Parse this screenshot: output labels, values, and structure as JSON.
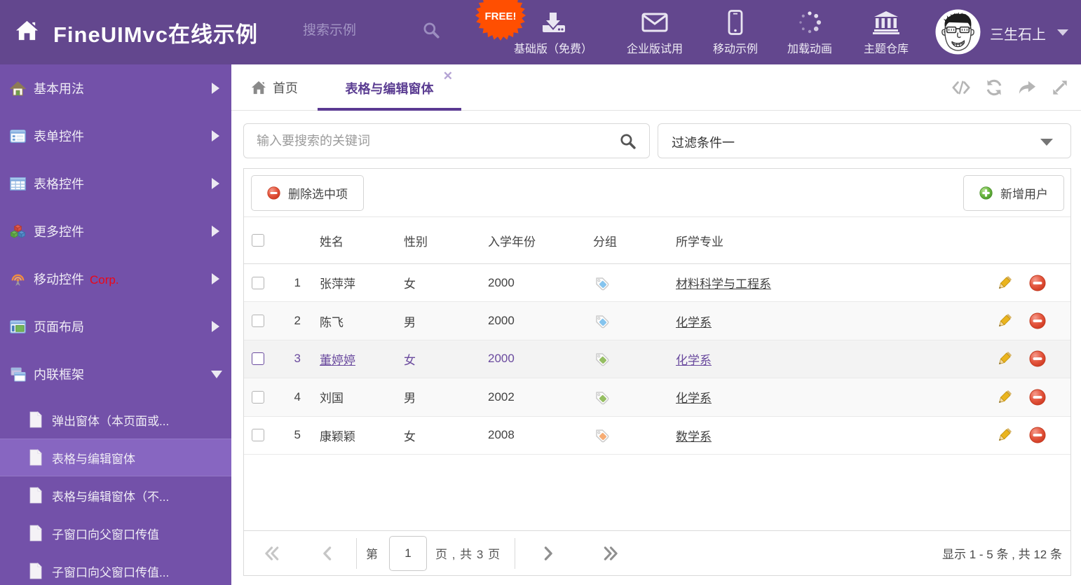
{
  "colors": {
    "header_bg": "#63478e",
    "sidebar_bg": "#7351a9",
    "sidebar_selected_bg": "#8766c1",
    "accent_purple": "#5b3d92",
    "selected_row_text": "#6a4a9e",
    "free_badge": "#ff4f01",
    "corp_red": "#ec0718",
    "tag_blue": "#85c4ee",
    "tag_green": "#95be62",
    "tag_orange": "#f6ac74",
    "pencil_gold": "#e8b31c",
    "delete_red": "#dd4936",
    "add_green": "#5fb140"
  },
  "header": {
    "title": "FineUIMvc在线示例",
    "search_placeholder": "搜索示例",
    "free_badge": "FREE!",
    "nav_items": [
      {
        "icon": "download-icon",
        "label": "基础版（免费）"
      },
      {
        "icon": "envelope-icon",
        "label": "企业版试用"
      },
      {
        "icon": "mobile-icon",
        "label": "移动示例"
      },
      {
        "icon": "spinner-icon",
        "label": "加载动画"
      },
      {
        "icon": "bank-icon",
        "label": "主题仓库"
      }
    ],
    "user": {
      "name": "三生石上"
    }
  },
  "sidebar": {
    "items": [
      {
        "icon": "home-icon",
        "label": "基本用法",
        "badge": "",
        "expanded": false
      },
      {
        "icon": "form-icon",
        "label": "表单控件",
        "badge": "",
        "expanded": false
      },
      {
        "icon": "table-icon",
        "label": "表格控件",
        "badge": "",
        "expanded": false
      },
      {
        "icon": "cubes-icon",
        "label": "更多控件",
        "badge": "",
        "expanded": false
      },
      {
        "icon": "wireless-icon",
        "label": "移动控件",
        "badge": "Corp.",
        "expanded": false
      },
      {
        "icon": "layout-icon",
        "label": "页面布局",
        "badge": "",
        "expanded": false
      },
      {
        "icon": "frames-icon",
        "label": "内联框架",
        "badge": "",
        "expanded": true
      }
    ],
    "submenu": {
      "parent": "内联框架",
      "items": [
        {
          "label": "弹出窗体（本页面或...",
          "selected": false
        },
        {
          "label": "表格与编辑窗体",
          "selected": true
        },
        {
          "label": "表格与编辑窗体（不...",
          "selected": false
        },
        {
          "label": "子窗口向父窗口传值",
          "selected": false
        },
        {
          "label": "子窗口向父窗口传值...",
          "selected": false
        }
      ]
    }
  },
  "tabs": {
    "home": {
      "label": "首页"
    },
    "active": {
      "label": "表格与编辑窗体",
      "close": "✕"
    },
    "tools": [
      "code-icon",
      "refresh-icon",
      "share-icon",
      "expand-icon"
    ]
  },
  "filters": {
    "search_placeholder": "输入要搜索的关键词",
    "filter_value": "过滤条件一"
  },
  "toolbar": {
    "delete_label": "删除选中项",
    "add_label": "新增用户"
  },
  "grid": {
    "columns": [
      "姓名",
      "性别",
      "入学年份",
      "分组",
      "所学专业"
    ],
    "rows": [
      {
        "num": "1",
        "name": "张萍萍",
        "gender": "女",
        "year": "2000",
        "tag": "blue",
        "major": "材料科学与工程系",
        "selected": false
      },
      {
        "num": "2",
        "name": "陈飞",
        "gender": "男",
        "year": "2000",
        "tag": "blue",
        "major": "化学系",
        "selected": false
      },
      {
        "num": "3",
        "name": "董婷婷",
        "gender": "女",
        "year": "2000",
        "tag": "green",
        "major": "化学系",
        "selected": true
      },
      {
        "num": "4",
        "name": "刘国",
        "gender": "男",
        "year": "2002",
        "tag": "green",
        "major": "化学系",
        "selected": false
      },
      {
        "num": "5",
        "name": "康颖颖",
        "gender": "女",
        "year": "2008",
        "tag": "orange",
        "major": "数学系",
        "selected": false
      }
    ]
  },
  "pagination": {
    "word_page_prefix": "第",
    "current_page": "1",
    "word_page_suffix": "页 , 共 3 页",
    "info": "显示 1 - 5 条 , 共 12 条"
  }
}
